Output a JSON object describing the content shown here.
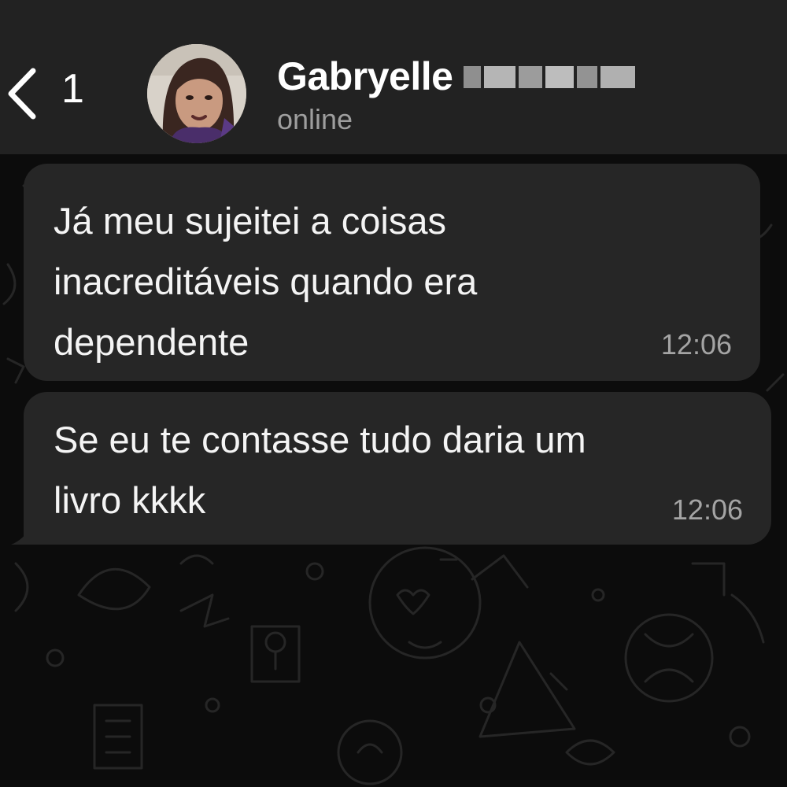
{
  "header": {
    "back_count": "1",
    "contact_name": "Gabryelle",
    "contact_status": "online"
  },
  "icons": {
    "back": "chevron-left-icon",
    "avatar": "contact-photo"
  },
  "messages": [
    {
      "direction": "incoming",
      "text": "Já meu sujeitei a coisas\ninacreditáveis quando era\ndependente",
      "time": "12:06"
    },
    {
      "direction": "incoming",
      "text": "Se eu te contasse tudo daria um\nlivro kkkk",
      "time": "12:06"
    }
  ],
  "colors": {
    "header_bg": "#222222",
    "chat_bg": "#0c0c0c",
    "bubble_bg": "#262626",
    "text": "#f4f4f4",
    "muted": "#9e9e9e"
  }
}
